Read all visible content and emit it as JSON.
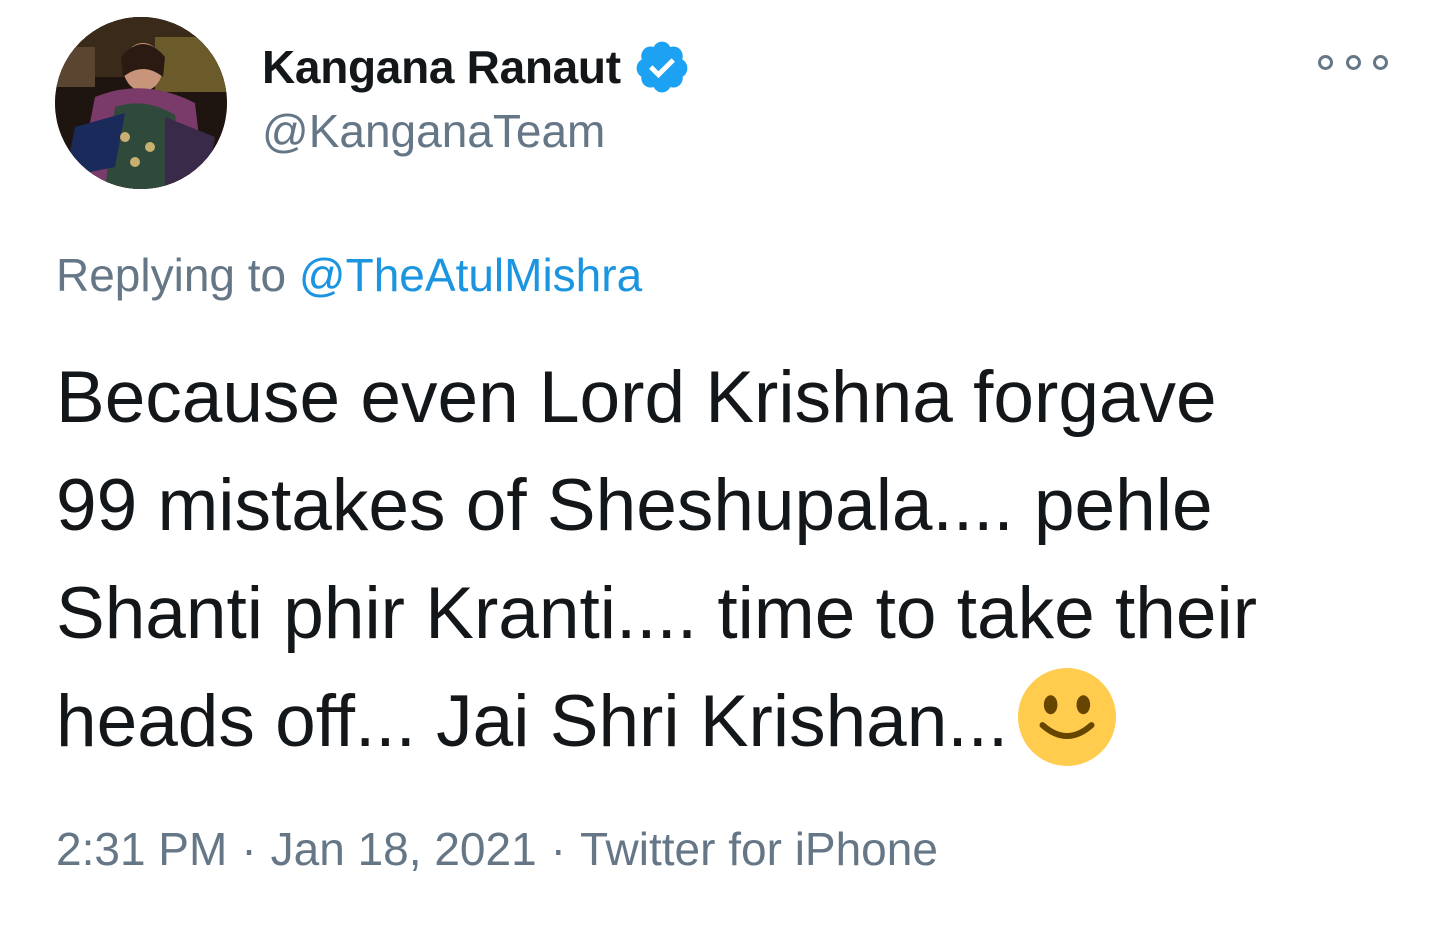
{
  "tweet": {
    "author": {
      "display_name": "Kangana Ranaut",
      "handle": "@KanganaTeam",
      "verified": true,
      "avatar_icon": "profile-photo",
      "verified_icon": "verified-badge-icon"
    },
    "more_icon": "more-options-icon",
    "reply_prefix": "Replying to",
    "reply_to": "@TheAtulMishra",
    "text_lines": [
      "Because even Lord Krishna forgave",
      "99 mistakes of Sheshupala.... pehle",
      "Shanti phir Kranti.... time to take their",
      "heads off... Jai Shri Krishan..."
    ],
    "emoji_icon": "slightly-smiling-face-icon",
    "time": "2:31 PM",
    "date": "Jan 18, 2021",
    "source": "Twitter for iPhone",
    "separator": "·",
    "colors": {
      "text": "#14171a",
      "secondary": "#657786",
      "link": "#1b95e0",
      "verified": "#1da1f2"
    }
  }
}
